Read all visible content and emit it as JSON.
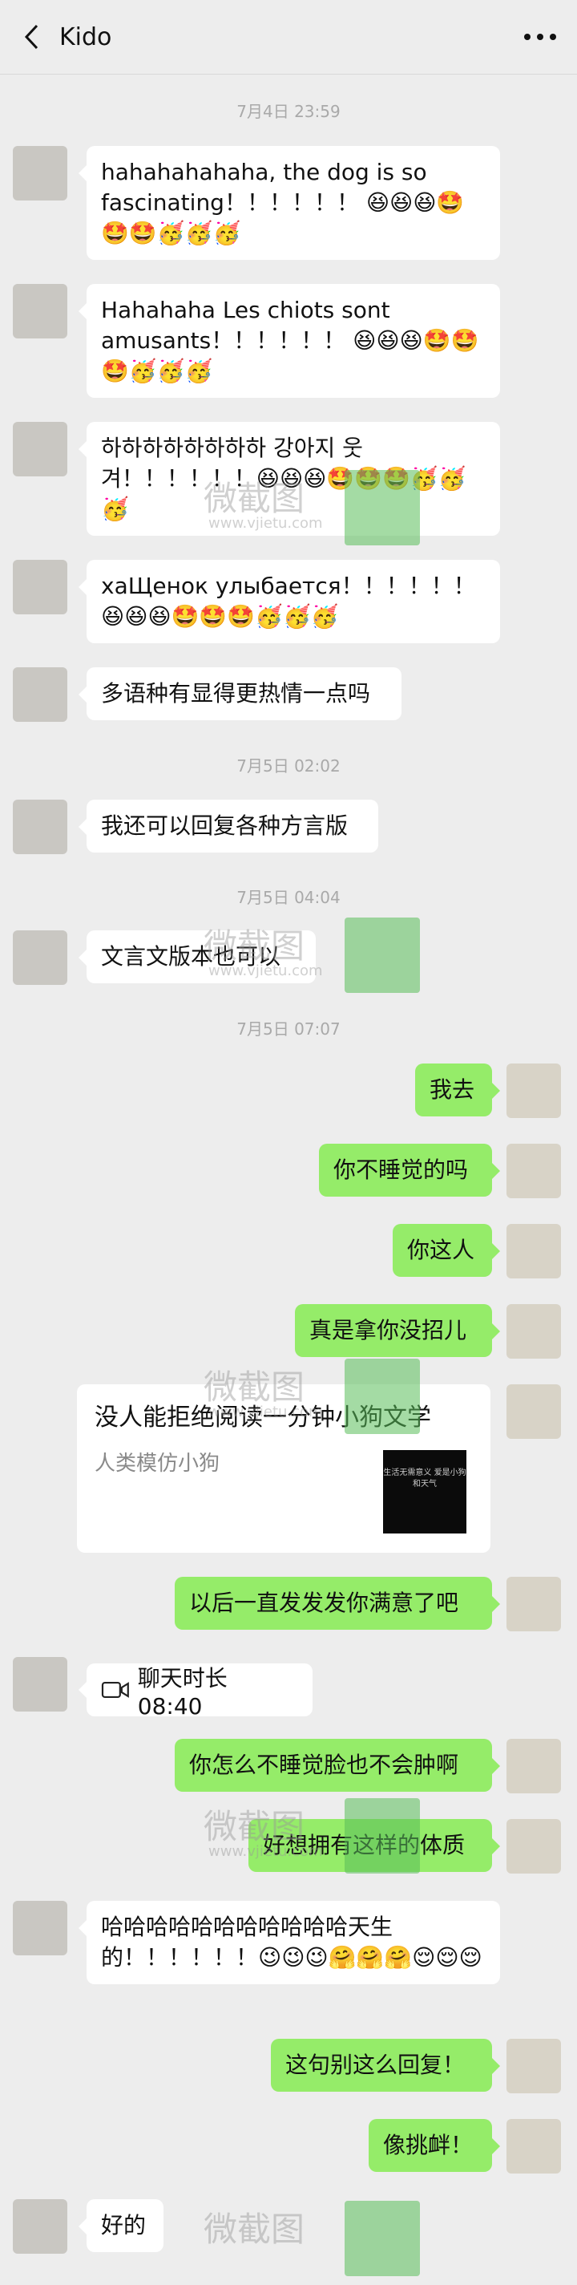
{
  "header": {
    "title": "Kido",
    "back_icon": "chevron-left-icon",
    "more_icon": "more-icon"
  },
  "timestamps": [
    "7月4日 23:59",
    "7月5日 02:02",
    "7月5日 04:04",
    "7月5日 07:07"
  ],
  "messages": [
    {
      "side": "left",
      "text": "hahahahahaha, the dog is so fascinating！！！！！！ 😆😆😆🤩🤩🤩🥳🥳🥳"
    },
    {
      "side": "left",
      "text": "Hahahaha Les chiots sont amusants！！！！！！ 😆😆😆🤩🤩🤩🥳🥳🥳"
    },
    {
      "side": "left",
      "text": "하하하하하하하하 강아지 웃겨！！！！！！😆😆😆🤩🤩🤩🥳🥳🥳"
    },
    {
      "side": "left",
      "text": "хаЩенок улыбается！！！！！！😆😆😆🤩🤩🤩🥳🥳🥳"
    },
    {
      "side": "left",
      "text": "多语种有显得更热情一点吗"
    },
    {
      "side": "left",
      "text": "我还可以回复各种方言版"
    },
    {
      "side": "left",
      "text": "文言文版本也可以"
    },
    {
      "side": "right",
      "text": "我去"
    },
    {
      "side": "right",
      "text": "你不睡觉的吗"
    },
    {
      "side": "right",
      "text": "你这人"
    },
    {
      "side": "right",
      "text": "真是拿你没招儿"
    },
    {
      "side": "right",
      "text": "以后一直发发发你满意了吧"
    },
    {
      "side": "right",
      "text": "你怎么不睡觉脸也不会肿啊"
    },
    {
      "side": "right",
      "text": "好想拥有这样的体质"
    },
    {
      "side": "left",
      "text": "哈哈哈哈哈哈哈哈哈哈哈天生的！！！！！！😉😉😉🤗🤗🤗😌😌😌"
    },
    {
      "side": "right",
      "text": "这句别这么回复！"
    },
    {
      "side": "right",
      "text": "像挑衅！"
    },
    {
      "side": "left",
      "text": "好的"
    }
  ],
  "card": {
    "title": "没人能拒绝阅读一分钟小狗文学",
    "subtitle": "人类模仿小狗",
    "thumb_text": "生活无需意义 爱是小狗和天气"
  },
  "call": {
    "label": "聊天时长 08:40",
    "icon": "video-call-icon"
  },
  "watermark": {
    "text": "微截图",
    "url": "www.vjietu.com"
  }
}
